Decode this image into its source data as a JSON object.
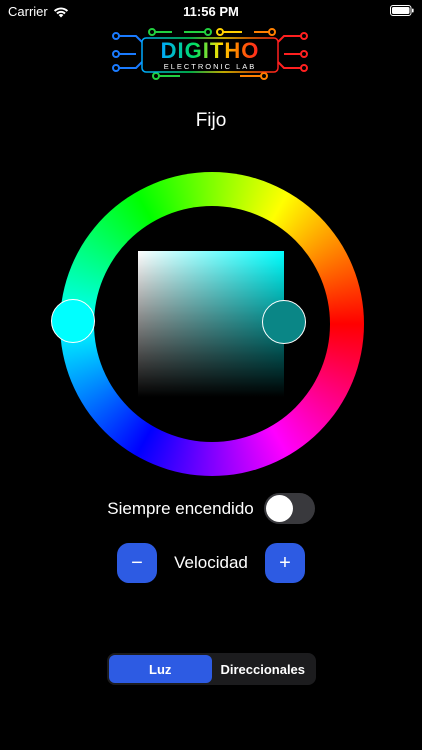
{
  "status_bar": {
    "carrier": "Carrier",
    "time": "11:56 PM",
    "icons": [
      "wifi-icon",
      "battery-icon"
    ]
  },
  "logo": {
    "title": "DIGITHO",
    "subtitle": "ELECTRONIC LAB"
  },
  "mode": {
    "title": "Fijo"
  },
  "color_picker": {
    "selected_color": "#00ffff",
    "square_handle_color": "#0a8686"
  },
  "always_on": {
    "label": "Siempre encendido",
    "checked": false
  },
  "speed": {
    "minus_label": "−",
    "label": "Velocidad",
    "plus_label": "+"
  },
  "segmented": {
    "options": [
      "Luz",
      "Direccionales"
    ],
    "selected_index": 0
  },
  "colors": {
    "accent": "#2d5be3",
    "background": "#000000",
    "toggle_off": "#39393d"
  }
}
